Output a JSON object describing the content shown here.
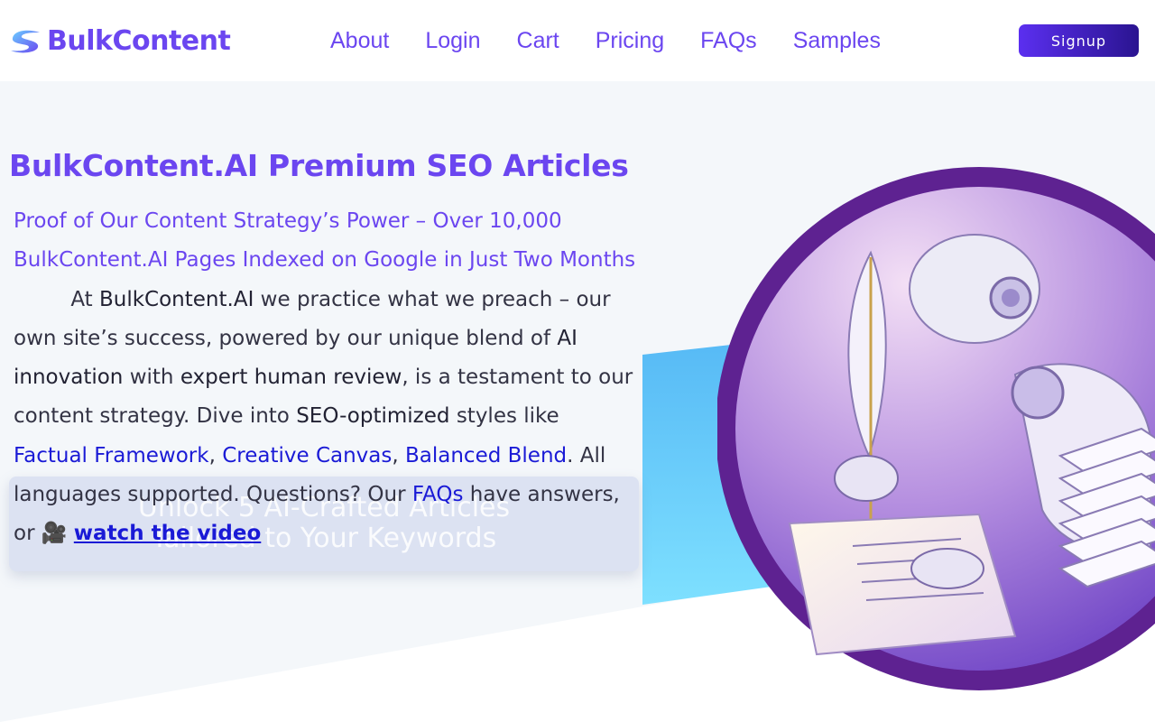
{
  "brand": {
    "name": "BulkContent"
  },
  "nav": {
    "items": [
      {
        "label": "About"
      },
      {
        "label": "Login"
      },
      {
        "label": "Cart"
      },
      {
        "label": "Pricing"
      },
      {
        "label": "FAQs"
      },
      {
        "label": "Samples"
      }
    ],
    "signup_label": "Signup"
  },
  "hero": {
    "title": "BulkContent.AI Premium SEO Articles",
    "proof": "Proof of Our Content Strategy’s Power – Over 10,000 BulkContent.AI Pages Indexed on Google in Just Two Months",
    "p_at": "At",
    "p_brand": "BulkContent.AI",
    "p_1": "we practice what we preach – our own site’s success, powered by our unique blend of",
    "p_ai": "AI innovation",
    "p_with": "with",
    "p_expert": "expert human review",
    "p_2": ", is a testament to our content strategy. Dive into",
    "p_seo": "SEO-optimized",
    "p_3": "styles like",
    "link_factual": "Factual Framework",
    "comma": ",",
    "link_creative": "Creative Canvas",
    "link_balanced": "Balanced Blend",
    "p_4": ". All languages supported. Questions? Our",
    "link_faqs": "FAQs",
    "p_5": "have answers, or",
    "video_emoji": "🎥",
    "link_video": "watch the video",
    "overlay_line1": "Unlock 5 AI-Crafted Articles",
    "overlay_line2": "Tailored to Your Keywords"
  },
  "colors": {
    "brand_purple": "#6b46f0",
    "link_blue": "#1a1ad6",
    "signup_gradient_start": "#5b2ff0",
    "signup_gradient_end": "#2a1490",
    "hero_bg": "#f4f7fa",
    "circle_ring": "#5e2291",
    "cyan_accent": "#6ed3fb"
  },
  "icons": {
    "logo": "s-swirl-logo-icon",
    "video": "movie-camera-emoji"
  }
}
